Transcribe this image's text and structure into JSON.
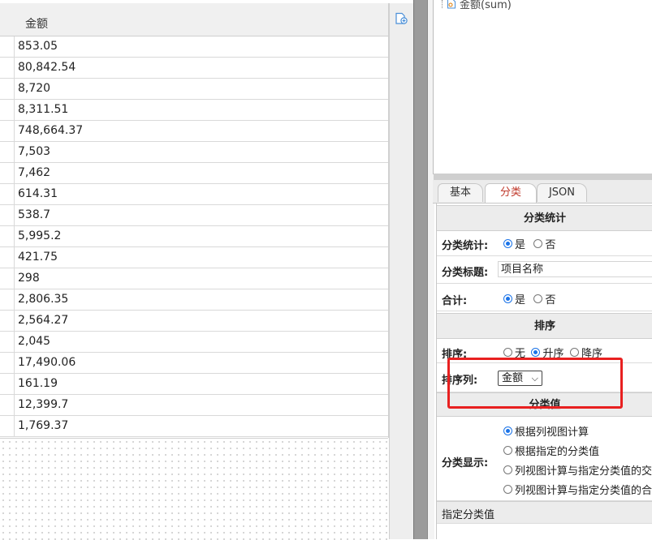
{
  "grid": {
    "column_header": "金额",
    "rows": [
      "853.05",
      "80,842.54",
      "8,720",
      "8,311.51",
      "748,664.37",
      "7,503",
      "7,462",
      "614.31",
      "538.7",
      "5,995.2",
      "421.75",
      "298",
      "2,806.35",
      "2,564.27",
      "2,045",
      "17,490.06",
      "161.19",
      "12,399.7",
      "1,769.37"
    ]
  },
  "tree": {
    "node_label": "金额(sum)"
  },
  "tabs": [
    {
      "label": "基本"
    },
    {
      "label": "分类"
    },
    {
      "label": "JSON"
    }
  ],
  "props": {
    "sec1_title": "分类统计",
    "stat_label": "分类统计:",
    "stat_yes": "是",
    "stat_no": "否",
    "title_label": "分类标题:",
    "title_value": "项目名称",
    "total_label": "合计:",
    "total_yes": "是",
    "total_no": "否",
    "sec2_title": "排序",
    "sort_label": "排序:",
    "sort_none": "无",
    "sort_asc": "升序",
    "sort_desc": "降序",
    "sortcol_label": "排序列:",
    "sortcol_value": "金额",
    "sec3_title": "分类值",
    "display_label": "分类显示:",
    "display_opts": [
      "根据列视图计算",
      "根据指定的分类值",
      "列视图计算与指定分类值的交集",
      "列视图计算与指定分类值的合集"
    ],
    "specified_label": "指定分类值"
  },
  "colors": {
    "accent": "#1a73e8",
    "highlight": "#e82020",
    "active_tab": "#c0392b"
  }
}
